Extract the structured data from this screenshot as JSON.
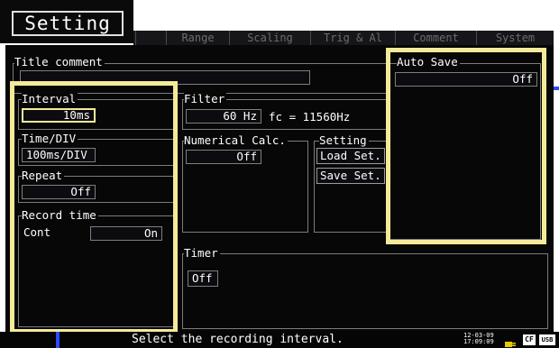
{
  "window": {
    "title": "Setting"
  },
  "tabs": [
    {
      "label": "Range"
    },
    {
      "label": "Scaling"
    },
    {
      "label": "Trig & Al"
    },
    {
      "label": "Comment"
    },
    {
      "label": "System"
    }
  ],
  "title_comment": {
    "label": "Title comment",
    "value": ""
  },
  "interval": {
    "label": "Interval",
    "value": "10ms"
  },
  "time_div": {
    "label": "Time/DIV",
    "value": "100ms/DIV"
  },
  "repeat": {
    "label": "Repeat",
    "value": "Off"
  },
  "record_time": {
    "label": "Record time",
    "mode": "Cont",
    "value": "On"
  },
  "filter": {
    "label": "Filter",
    "value": "60 Hz",
    "fc_text": "fc = 11560Hz"
  },
  "numerical_calc": {
    "label": "Numerical Calc.",
    "value": "Off"
  },
  "setting_group": {
    "label": "Setting",
    "load_label": "Load Set.",
    "save_label": "Save Set."
  },
  "auto_save": {
    "label": "Auto Save",
    "value": "Off"
  },
  "timer": {
    "label": "Timer",
    "value": "Off"
  },
  "status": {
    "message": "Select the recording interval.",
    "date": "12-03-09",
    "time": "17:09:09",
    "cf_label": "CF",
    "usb_label": "USB"
  },
  "colors": {
    "highlight": "#f5ea9a",
    "background": "#070708",
    "accent_blue": "#2b4cff"
  }
}
